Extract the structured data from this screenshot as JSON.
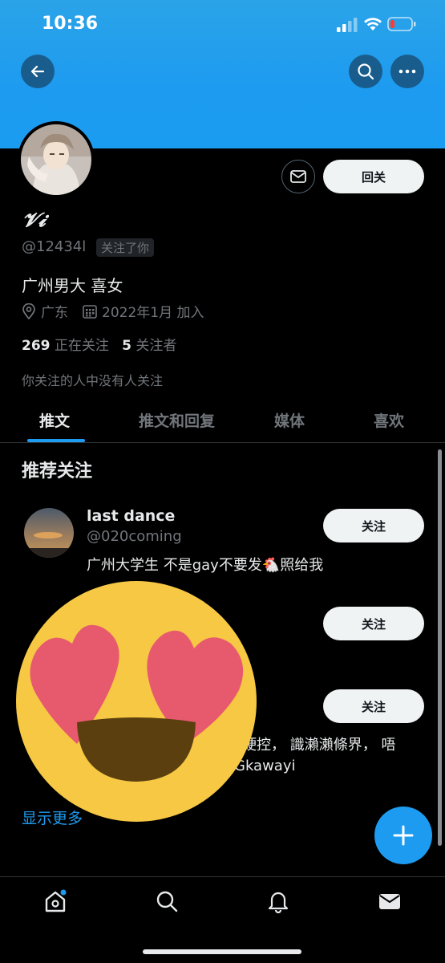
{
  "status_bar": {
    "time": "10:36"
  },
  "profile": {
    "display_name": "𝓥𝓲",
    "handle": "@12434l",
    "follows_you": "关注了你",
    "bio": "广州男大 喜女",
    "location": "广东",
    "joined": "2022年1月 加入",
    "following_count": "269",
    "following_label": "正在关注",
    "followers_count": "5",
    "followers_label": "关注者",
    "mutual_note": "你关注的人中没有人关注",
    "follow_back_label": "回关"
  },
  "tabs": [
    {
      "label": "推文"
    },
    {
      "label": "推文和回复"
    },
    {
      "label": "媒体"
    },
    {
      "label": "喜欢"
    }
  ],
  "recommended": {
    "title": "推荐关注",
    "items": [
      {
        "name": "last dance",
        "handle": "@020coming",
        "bio": "广州大学生 不是gay不要发🐔照给我",
        "follow_label": "关注"
      },
      {
        "follow_label": "关注"
      },
      {
        "follow_label": "关注",
        "bio_line1": "硬控， 識瀨瀨條界， 唔",
        "bio_line2": "Gkawayi"
      }
    ],
    "show_more": "显示更多"
  },
  "icons": {
    "back": "arrow-left-icon",
    "search": "search-icon",
    "more": "more-horizontal-icon",
    "message": "envelope-icon",
    "location": "location-pin-icon",
    "calendar": "calendar-icon",
    "compose": "plus-icon",
    "home": "home-icon",
    "explore": "search-icon",
    "notifications": "bell-icon",
    "messages": "envelope-icon"
  },
  "colors": {
    "accent": "#1d9bf0",
    "banner": "#1d9bf0",
    "background": "#000000"
  }
}
